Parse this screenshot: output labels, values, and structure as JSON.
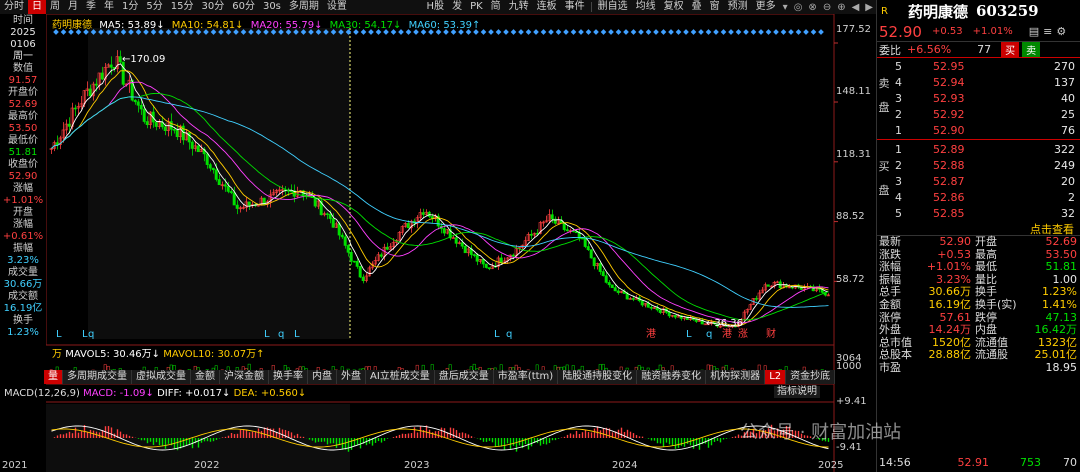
{
  "toolbar": {
    "left_items": [
      "分时",
      "日",
      "周",
      "月",
      "季",
      "年",
      "1分",
      "5分",
      "15分",
      "30分",
      "60分",
      "30s",
      "多周期",
      "设置"
    ],
    "active_index": 1,
    "right_items": [
      "H股",
      "发",
      "PK",
      "简",
      "九转",
      "连板",
      "事件",
      "删自选",
      "均线",
      "复权",
      "叠",
      "窗",
      "预测",
      "更多"
    ]
  },
  "info": {
    "time_label": "时间",
    "year": "2025",
    "date": "0106",
    "weekday": "周一",
    "value_label": "数值",
    "value": "91.57",
    "open_label": "开盘价",
    "open": "52.69",
    "high_label": "最高价",
    "high": "53.50",
    "low_label": "最低价",
    "low": "51.81",
    "close_label": "收盘价",
    "close": "52.90",
    "chg_label": "涨幅",
    "chg": "+1.01%",
    "open_chg_label1": "开盘",
    "open_chg_label2": "涨幅",
    "open_chg": "+0.61%",
    "amp_label": "振幅",
    "amp": "3.23%",
    "vol_label": "成交量",
    "vol": "30.66万",
    "amt_label": "成交额",
    "amt": "16.19亿",
    "turn_label": "换手",
    "turn": "1.23%"
  },
  "legend": {
    "name": "药明康德",
    "ma5": "MA5: 53.89↓",
    "ma10": "MA10: 54.81↓",
    "ma20": "MA20: 55.79↓",
    "ma30": "MA30: 54.17↓",
    "ma60": "MA60: 53.39↑"
  },
  "colors": {
    "ma5": "#ffffff",
    "ma10": "#ffcc00",
    "ma20": "#ff40ff",
    "ma30": "#00e000",
    "ma60": "#40d0ff",
    "up": "#ff4040",
    "down": "#00e000"
  },
  "chart_data": {
    "type": "candlestick",
    "title": "药明康德 603259",
    "y_ticks": [
      "177.52",
      "148.11",
      "118.31",
      "88.52",
      "58.72"
    ],
    "x_ticks": [
      "2021",
      "2022",
      "2023",
      "2024",
      "2025"
    ],
    "price_series": [
      {
        "x": "2021-01",
        "close": 125
      },
      {
        "x": "2021-03",
        "close": 150
      },
      {
        "x": "2021-06",
        "close": 170.09
      },
      {
        "x": "2021-08",
        "close": 140
      },
      {
        "x": "2021-10",
        "close": 135
      },
      {
        "x": "2021-12",
        "close": 120
      },
      {
        "x": "2022-02",
        "close": 95
      },
      {
        "x": "2022-04",
        "close": 100
      },
      {
        "x": "2022-06",
        "close": 105
      },
      {
        "x": "2022-08",
        "close": 90
      },
      {
        "x": "2022-10",
        "close": 60
      },
      {
        "x": "2022-12",
        "close": 80
      },
      {
        "x": "2023-02",
        "close": 95
      },
      {
        "x": "2023-04",
        "close": 80
      },
      {
        "x": "2023-06",
        "close": 65
      },
      {
        "x": "2023-08",
        "close": 75
      },
      {
        "x": "2023-10",
        "close": 90
      },
      {
        "x": "2023-12",
        "close": 80
      },
      {
        "x": "2024-02",
        "close": 55
      },
      {
        "x": "2024-04",
        "close": 48
      },
      {
        "x": "2024-06",
        "close": 42
      },
      {
        "x": "2024-08",
        "close": 38
      },
      {
        "x": "2024-09",
        "close": 36.36
      },
      {
        "x": "2024-10",
        "close": 58
      },
      {
        "x": "2024-12",
        "close": 56
      },
      {
        "x": "2025-01",
        "close": 52.9
      }
    ],
    "high_annotation": "170.09",
    "low_annotation": "36.36",
    "ylim": [
      30,
      185
    ],
    "markers": [
      "L",
      "L",
      "q",
      "L",
      "q",
      "L",
      "L",
      "q",
      "港",
      "L",
      "q",
      "港",
      "涨",
      "财"
    ]
  },
  "volume": {
    "mavol5": "MAVOL5: 30.46万↓",
    "mavol10": "MAVOL10: 30.07万↑",
    "unit": "万",
    "ticks": [
      "3064",
      "1000"
    ]
  },
  "indicator_tabs": [
    "量",
    "多周期成交量",
    "虚拟成交量",
    "金额",
    "沪深金额",
    "换手率",
    "内盘",
    "外盘",
    "AI立桩成交量",
    "盘后成交量",
    "市盈率(ttm)",
    "陆股通持股变化",
    "融资融券变化",
    "机构探测器",
    "L2",
    "资金抄底"
  ],
  "indicator_active": 0,
  "indicator_label": "指标说明",
  "macd": {
    "params": "MACD(12,26,9)",
    "macd": "MACD: -1.09↓",
    "diff": "DIFF: +0.017↓",
    "dea": "DEA: +0.560↓",
    "tick": "+9.41",
    "tick_low": "-9.41"
  },
  "right": {
    "r_label": "R",
    "name": "药明康德",
    "code": "603259",
    "price": "52.90",
    "change": "+0.53",
    "pct": "+1.01%",
    "ratio_label": "委比",
    "ratio": "+6.56%",
    "ratio_n": "77",
    "buy_btn": "买",
    "sell_btn": "卖",
    "sell_label": "卖盘",
    "buy_label": "买盘",
    "asks": [
      {
        "lv": "5",
        "p": "52.95",
        "v": "270"
      },
      {
        "lv": "4",
        "p": "52.94",
        "v": "137"
      },
      {
        "lv": "3",
        "p": "52.93",
        "v": "40"
      },
      {
        "lv": "2",
        "p": "52.92",
        "v": "25"
      },
      {
        "lv": "1",
        "p": "52.90",
        "v": "76"
      }
    ],
    "bids": [
      {
        "lv": "1",
        "p": "52.89",
        "v": "322"
      },
      {
        "lv": "2",
        "p": "52.88",
        "v": "249"
      },
      {
        "lv": "3",
        "p": "52.87",
        "v": "20"
      },
      {
        "lv": "4",
        "p": "52.86",
        "v": "2"
      },
      {
        "lv": "5",
        "p": "52.85",
        "v": "32"
      }
    ],
    "link": "点击查看",
    "stats": [
      {
        "k1": "最新",
        "v1": "52.90",
        "c1": "red",
        "k2": "开盘",
        "v2": "52.69",
        "c2": "red"
      },
      {
        "k1": "涨跌",
        "v1": "+0.53",
        "c1": "red",
        "k2": "最高",
        "v2": "53.50",
        "c2": "red"
      },
      {
        "k1": "涨幅",
        "v1": "+1.01%",
        "c1": "red",
        "k2": "最低",
        "v2": "51.81",
        "c2": "green"
      },
      {
        "k1": "振幅",
        "v1": "3.23%",
        "c1": "red",
        "k2": "量比",
        "v2": "1.00",
        "c2": "white"
      },
      {
        "k1": "总手",
        "v1": "30.66万",
        "c1": "yellow",
        "k2": "换手",
        "v2": "1.23%",
        "c2": "yellow"
      },
      {
        "k1": "金额",
        "v1": "16.19亿",
        "c1": "yellow",
        "k2": "换手(实)",
        "v2": "1.41%",
        "c2": "yellow"
      },
      {
        "k1": "涨停",
        "v1": "57.61",
        "c1": "red",
        "k2": "跌停",
        "v2": "47.13",
        "c2": "green"
      },
      {
        "k1": "外盘",
        "v1": "14.24万",
        "c1": "red",
        "k2": "内盘",
        "v2": "16.42万",
        "c2": "green"
      },
      {
        "k1": "总市值",
        "v1": "1520亿",
        "c1": "yellow",
        "k2": "流通值",
        "v2": "1323亿",
        "c2": "yellow"
      },
      {
        "k1": "总股本",
        "v1": "28.88亿",
        "c1": "yellow",
        "k2": "流通股",
        "v2": "25.01亿",
        "c2": "yellow"
      },
      {
        "k1": "市盈",
        "v1": "",
        "c1": "white",
        "k2": "",
        "v2": "18.95",
        "c2": "white"
      },
      {
        "k1": "",
        "v1": "",
        "c1": "white",
        "k2": "",
        "v2": "",
        "c2": "white"
      }
    ],
    "tick": {
      "time": "14:56",
      "price": "52.91",
      "vol": "753",
      "n": "70"
    }
  },
  "watermark": "公众号 · 财富加油站"
}
